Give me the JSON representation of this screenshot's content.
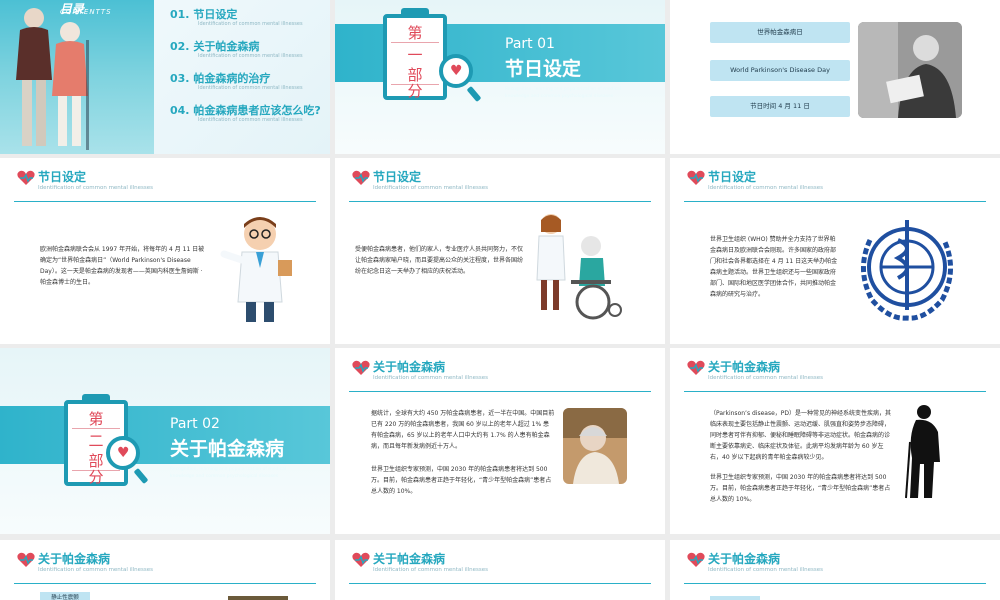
{
  "contents": {
    "title": "目录",
    "subtitle": "CONTENTTS",
    "items": [
      {
        "label": "01. 节日设定",
        "sub": "Identification of common mental illnesses"
      },
      {
        "label": "02. 关于帕金森病",
        "sub": "Identification of common mental illnesses"
      },
      {
        "label": "03. 帕金森病的治疗",
        "sub": "Identification of common mental illnesses"
      },
      {
        "label": "04. 帕金森病患者应该怎么吃?",
        "sub": "Identification of common mental illnesses"
      }
    ]
  },
  "part1": {
    "clip_chars": [
      "第",
      "一",
      "部",
      "分"
    ],
    "part_no": "Part 01",
    "title": "节日设定",
    "sub": "Recognition, learning and popularization of medical knowledge and common psychological diseases"
  },
  "info": {
    "pills": [
      "世界帕金森病日",
      "World Parkinson's Disease Day",
      "节日时间 4 月 11 日"
    ]
  },
  "header": {
    "jieri": "节日设定",
    "about": "关于帕金森病",
    "sub": "Identification of common mental illnesses"
  },
  "text": {
    "s4": "欧洲帕金森病联合会从 1997 年开始，将每年的 4 月 11 日被确定为“世界帕金森病日”（World Parkinson's Disease Day）。这一天是帕金森病的发现者——英国内科医生詹姆斯 · 帕金森博士的生日。",
    "s5": "受便帕金森病患者，他们的家人，专业医疗人员共同努力，不仅让帕金森病家喻户晓，而且要提高公众的关注程度，世界各国纷纷在纪念日这一天举办了相应的庆祝活动。",
    "s6": "世界卫生组织 (WHO) 赞助并全力支持了世界帕金森病日及欧洲联合会刚现。许多国家的政府部门和社会各界都选择在 4 月 11 日这天举办帕金森病主题活动。世界卫生组织还与一些国家政府部门、国际和地区医学团体合作，共同推动帕金森病的研究与治疗。",
    "s8a": "据统计，全球有大约 450 万帕金森病患者，近一半在中国。中国目前已有 220 万的帕金森病患者，我国 60 岁以上的老年人超过 1% 患有帕金森病，65 岁以上的老年人口中大约有 1.7% 的人患有帕金森病，而且每年新发病例近十万人。",
    "s8b": "世界卫生组织专家预测，中国 2030 年的帕金森病患者将达到 500 万。目前，帕金森病患者正趋于年轻化，“青少年型帕金森病”患者占总人数的 10%。",
    "s9a": "（Parkinson’s disease，PD）是一种常见的神经系统变性疾病，其临床表现主要包括静止性震颤、运动迟缓、肌强直和姿势步态障碍，同时患者可伴有抑郁、便秘和睡眠障碍等非运动症状。帕金森病的诊断主要依靠病史、临床症状及体征。此病平均发病年龄为 60 岁左右，40 岁以下起病的青年帕金森病较少见。",
    "s9b": "世界卫生组织专家预测，中国 2030 年的帕金森病患者将达到 500 万。目前，帕金森病患者正趋于年轻化，“青少年型帕金森病”患者占总人数的 10%。"
  },
  "part2": {
    "clip_chars": [
      "第",
      "二",
      "部",
      "分"
    ],
    "part_no": "Part 02",
    "title": "关于帕金森病",
    "sub": "Recognition, learning and popularization of medical knowledge and common psychological diseases"
  },
  "row4": {
    "tag": "静止性震颤"
  },
  "colors": {
    "accent": "#26a8bf",
    "band": "#2fb3cb",
    "pill": "#bfe4f2",
    "red": "#e04a5a"
  }
}
